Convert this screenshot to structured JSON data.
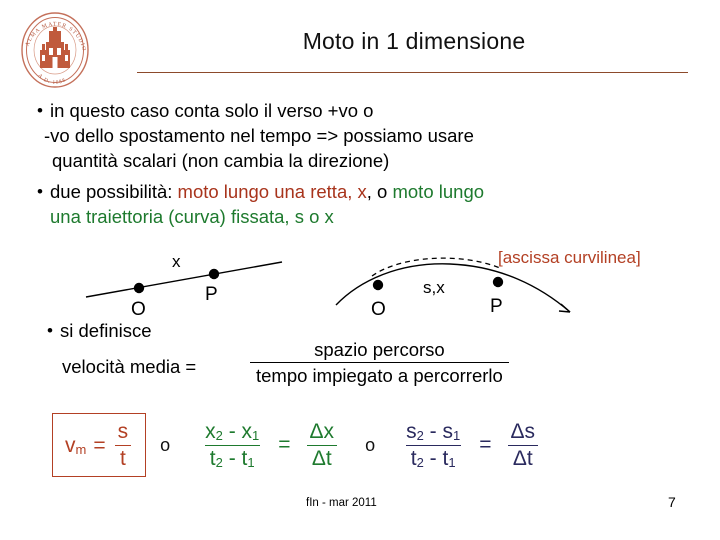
{
  "slide": {
    "title": "Moto in 1 dimensione",
    "logo_alt": "alma-mater-studiorum-seal",
    "accent_rule_color": "#8C4A2B"
  },
  "bullets": [
    {
      "marker": "•",
      "lines": [
        "in questo caso conta solo il verso +vo o",
        "-vo dello spostamento nel tempo => possiamo usare",
        "quantità scalari (non cambia la direzione)"
      ]
    },
    {
      "marker": "•",
      "lead": "due possibilità: ",
      "red_part": "moto lungo una retta, x",
      "mid": ", o ",
      "green_part_1": "moto lungo",
      "green_part_2": "una traiettoria (curva) fissata, s o x"
    }
  ],
  "figures": {
    "line_diagram": {
      "axis_label": "x",
      "origin_label": "O",
      "point_label": "P"
    },
    "curve_diagram": {
      "axis_label": "s,x",
      "origin_label": "O",
      "point_label": "P",
      "annotation": "[ascissa curvilinea]",
      "annotation_color": "#B34024"
    }
  },
  "definition": {
    "marker": "•",
    "lead": "si definisce",
    "left_side": "velocità media  =",
    "numerator": "spazio percorso",
    "denominator": "tempo impiegato a percorrerlo"
  },
  "equations": {
    "boxed": {
      "symbol": "v",
      "subscript": "m",
      "equals": "=",
      "numerator": "s",
      "denominator": "t",
      "color": "#B34024"
    },
    "or_1": "o",
    "green": {
      "numerator_a": "x",
      "numerator_a_sub": "2",
      "minus": " - ",
      "numerator_b": "x",
      "numerator_b_sub": "1",
      "denominator_a": "t",
      "denominator_a_sub": "2",
      "denominator_b": "t",
      "denominator_b_sub": "1",
      "equals": "=",
      "delta_num": "Δx",
      "delta_den": "Δt",
      "color": "#1E7A2E"
    },
    "or_2": "o",
    "navy": {
      "numerator_a": "s",
      "numerator_a_sub": "2",
      "minus": " - ",
      "numerator_b": "s",
      "numerator_b_sub": "1",
      "denominator_a": "t",
      "denominator_a_sub": "2",
      "denominator_b": "t",
      "denominator_b_sub": "1",
      "equals": "=",
      "delta_num": "Δs",
      "delta_den": "Δt",
      "color": "#2A2A5E"
    }
  },
  "footer": {
    "note": "fIn - mar 2011",
    "page_number": "7"
  }
}
